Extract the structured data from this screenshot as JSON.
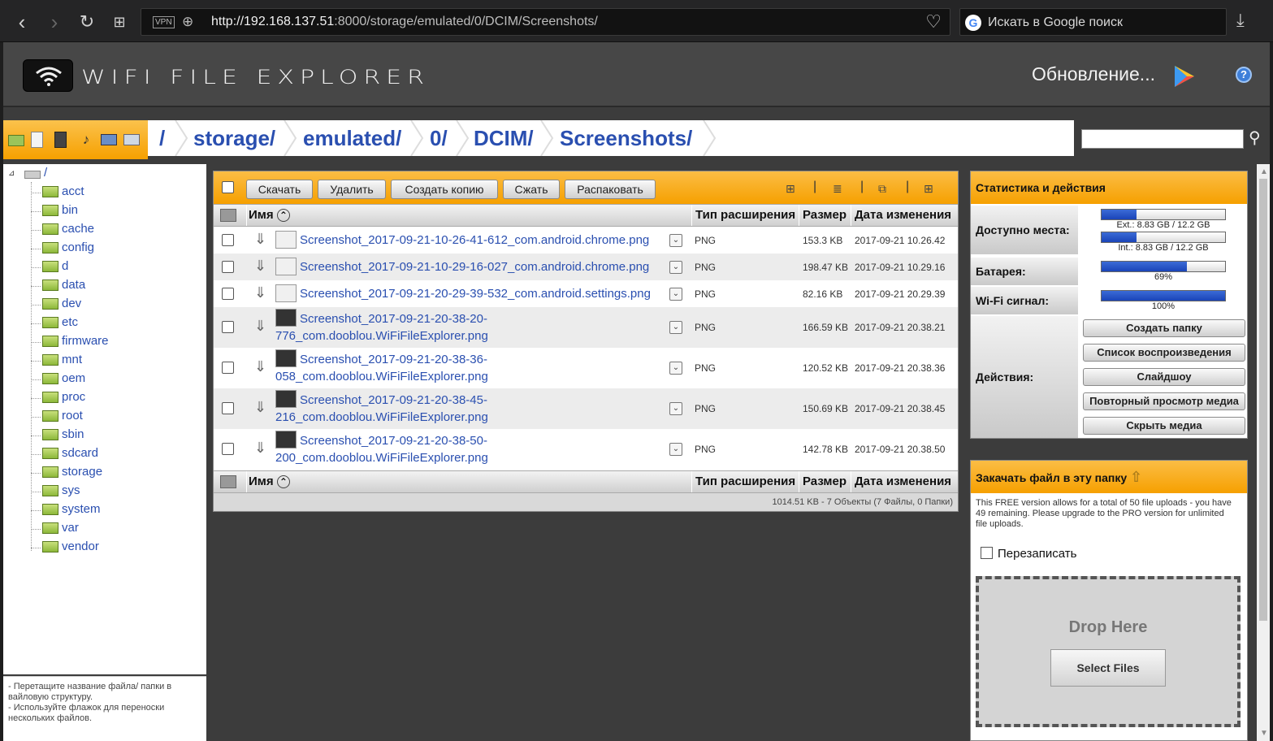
{
  "browser": {
    "url_host": "http://192.168.137.51",
    "url_rest": ":8000/storage/emulated/0/DCIM/Screenshots/",
    "vpn": "VPN",
    "search_placeholder": "Искать в Google поиск"
  },
  "header": {
    "logo": "WIFI FILE EXPLORER",
    "update": "Обновление...",
    "help": "?"
  },
  "path": {
    "crumbs": [
      "/",
      "storage/",
      "emulated/",
      "0/",
      "DCIM/",
      "Screenshots/"
    ]
  },
  "tree": {
    "root": "/",
    "items": [
      "acct",
      "bin",
      "cache",
      "config",
      "d",
      "data",
      "dev",
      "etc",
      "firmware",
      "mnt",
      "oem",
      "proc",
      "root",
      "sbin",
      "sdcard",
      "storage",
      "sys",
      "system",
      "var",
      "vendor"
    ],
    "hint1": "- Перетащите название файла/ папки в вайловую структуру.",
    "hint2": "- Используйте флажок для переноски нескольких файлов."
  },
  "toolbar": {
    "download": "Скачать",
    "delete": "Удалить",
    "copy": "Создать копию",
    "zip": "Сжать",
    "unzip": "Распаковать"
  },
  "table": {
    "col_name": "Имя",
    "col_type": "Тип расширения",
    "col_size": "Размер",
    "col_date": "Дата изменения",
    "rows": [
      {
        "l1": "Screenshot_2017-09-21-10-26-41-612_com.android.chrome.png",
        "l2": "",
        "type": "PNG",
        "size": "153.3 KB",
        "date": "2017-09-21 10.26.42"
      },
      {
        "l1": "Screenshot_2017-09-21-10-29-16-027_com.android.chrome.png",
        "l2": "",
        "type": "PNG",
        "size": "198.47 KB",
        "date": "2017-09-21 10.29.16"
      },
      {
        "l1": "Screenshot_2017-09-21-20-29-39-532_com.android.settings.png",
        "l2": "",
        "type": "PNG",
        "size": "82.16 KB",
        "date": "2017-09-21 20.29.39"
      },
      {
        "l1": "Screenshot_2017-09-21-20-38-20-",
        "l2": "776_com.dooblou.WiFiFileExplorer.png",
        "type": "PNG",
        "size": "166.59 KB",
        "date": "2017-09-21 20.38.21"
      },
      {
        "l1": "Screenshot_2017-09-21-20-38-36-",
        "l2": "058_com.dooblou.WiFiFileExplorer.png",
        "type": "PNG",
        "size": "120.52 KB",
        "date": "2017-09-21 20.38.36"
      },
      {
        "l1": "Screenshot_2017-09-21-20-38-45-",
        "l2": "216_com.dooblou.WiFiFileExplorer.png",
        "type": "PNG",
        "size": "150.69 KB",
        "date": "2017-09-21 20.38.45"
      },
      {
        "l1": "Screenshot_2017-09-21-20-38-50-",
        "l2": "200_com.dooblou.WiFiFileExplorer.png",
        "type": "PNG",
        "size": "142.78 KB",
        "date": "2017-09-21 20.38.50"
      }
    ],
    "footer": "1014.51 KB - 7 Объекты (7 Файлы, 0 Папки)"
  },
  "stats": {
    "title": "Статистика и действия",
    "space": "Доступно места:",
    "ext": "Ext.: 8.83 GB / 12.2 GB",
    "ext_fill": 0.28,
    "int": "Int.: 8.83 GB / 12.2 GB",
    "int_fill": 0.28,
    "battery": "Батарея:",
    "battery_val": "69%",
    "battery_fill": 0.69,
    "wifi": "Wi-Fi сигнал:",
    "wifi_val": "100%",
    "wifi_fill": 1.0,
    "actions": "Действия:",
    "btn_folder": "Создать папку",
    "btn_playlist": "Список воспроизведения",
    "btn_slideshow": "Слайдшоу",
    "btn_rescan": "Повторный просмотр медиа",
    "btn_hide": "Скрыть медиа"
  },
  "upload": {
    "title": "Закачать файл в эту папку",
    "note": "This FREE version allows for a total of 50 file uploads - you have 49 remaining. Please upgrade to the PRO version for unlimited file uploads.",
    "overwrite": "Перезаписать",
    "drop": "Drop Here",
    "select": "Select Files"
  },
  "colors": {
    "accent": "#f6a000",
    "link": "#2a4fb0"
  }
}
